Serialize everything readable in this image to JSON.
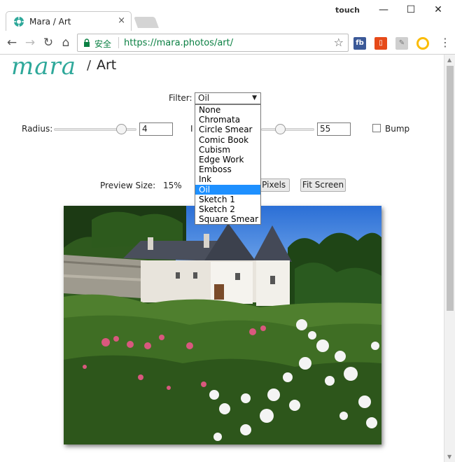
{
  "browser": {
    "tab_title": "Mara / Art",
    "tab_close": "×",
    "profile_label": "touch",
    "secure_label": "安全",
    "url": "https://mara.photos/art/",
    "extension_fb": "fb"
  },
  "page": {
    "logo": "mara",
    "breadcrumb_sep": "/",
    "breadcrumb_page": "Art"
  },
  "controls": {
    "filter_label": "Filter:",
    "filter_value": "Oil",
    "filter_options": [
      "None",
      "Chromata",
      "Circle Smear",
      "Comic Book",
      "Cubism",
      "Edge Work",
      "Emboss",
      "Ink",
      "Oil",
      "Sketch 1",
      "Sketch 2",
      "Square Smear"
    ],
    "radius_label": "Radius:",
    "radius_value": "4",
    "radius_fraction": 0.86,
    "second_label_partial": "I",
    "second_value": "55",
    "second_fraction": 0.32,
    "bump_label": "Bump",
    "bump_checked": false,
    "preview_size_label": "Preview Size:",
    "preview_size_value": "15%",
    "actual_pixels_partial": "l Pixels",
    "fit_screen": "Fit Screen"
  },
  "colors": {
    "logo": "#2ea89a",
    "selected_option": "#1e90ff",
    "secure": "#0b8043"
  }
}
